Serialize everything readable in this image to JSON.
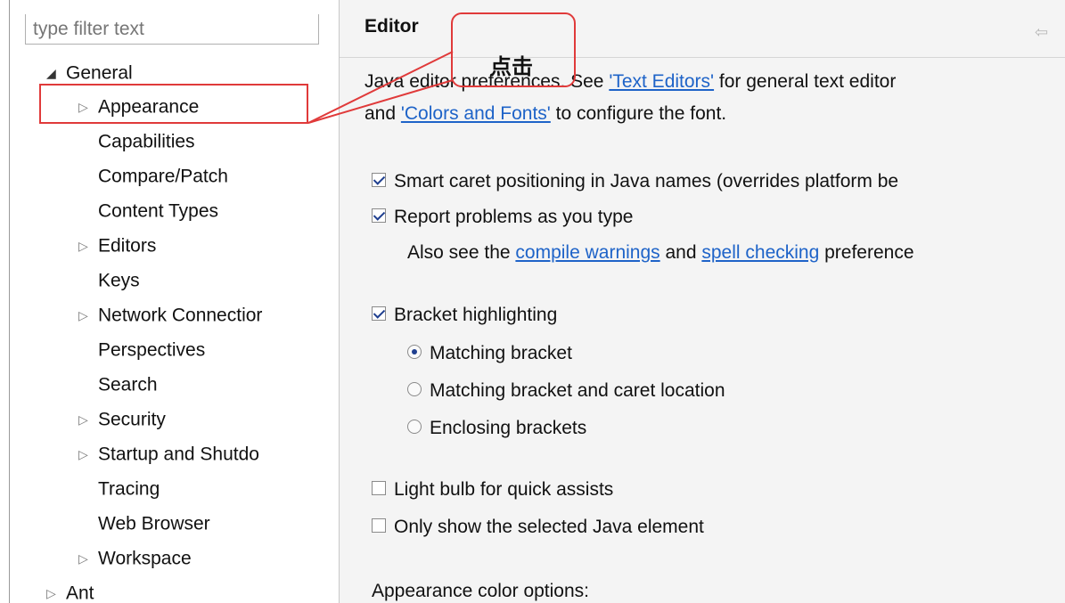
{
  "tree": {
    "filter_placeholder": "type filter text",
    "items": [
      {
        "label": "General",
        "arrow": "◢"
      },
      {
        "label": "Appearance",
        "arrow": "▷"
      },
      {
        "label": "Capabilities",
        "arrow": ""
      },
      {
        "label": "Compare/Patch",
        "arrow": ""
      },
      {
        "label": "Content Types",
        "arrow": ""
      },
      {
        "label": "Editors",
        "arrow": "▷"
      },
      {
        "label": "Keys",
        "arrow": ""
      },
      {
        "label": "Network Connectior",
        "arrow": "▷"
      },
      {
        "label": "Perspectives",
        "arrow": ""
      },
      {
        "label": "Search",
        "arrow": ""
      },
      {
        "label": "Security",
        "arrow": "▷"
      },
      {
        "label": "Startup and Shutdo",
        "arrow": "▷"
      },
      {
        "label": "Tracing",
        "arrow": ""
      },
      {
        "label": "Web Browser",
        "arrow": ""
      },
      {
        "label": "Workspace",
        "arrow": "▷"
      },
      {
        "label": "Ant",
        "arrow": "▷"
      }
    ]
  },
  "editor": {
    "title": "Editor",
    "intro_line1_prefix": "Java editor preferences. See ",
    "intro_link1": "'Text Editors'",
    "intro_line1_suffix": " for general text editor",
    "intro_line2_prefix": "and ",
    "intro_link2": "'Colors and Fonts'",
    "intro_line2_suffix": " to configure the font.",
    "smart_caret": {
      "label": "Smart caret positioning in Java names (overrides platform be",
      "checked": true
    },
    "report_problems": {
      "label": "Report problems as you type",
      "checked": true
    },
    "also_see_prefix": "Also see the ",
    "compile_warnings_link": "compile warnings",
    "also_see_mid": " and ",
    "spell_checking_link": "spell checking",
    "also_see_suffix": " preference",
    "bracket_highlighting": {
      "label": "Bracket highlighting",
      "checked": true
    },
    "radio_matching": {
      "label": "Matching bracket",
      "checked": true
    },
    "radio_caret": {
      "label": "Matching bracket and caret location",
      "checked": false
    },
    "radio_enclosing": {
      "label": "Enclosing brackets",
      "checked": false
    },
    "light_bulb": {
      "label": "Light bulb for quick assists",
      "checked": false
    },
    "only_selected": {
      "label": "Only show the selected Java element",
      "checked": false
    },
    "appearance_color_options": "Appearance color options:"
  },
  "annotation": {
    "callout_text": "点击",
    "color": "#e03a3a"
  }
}
